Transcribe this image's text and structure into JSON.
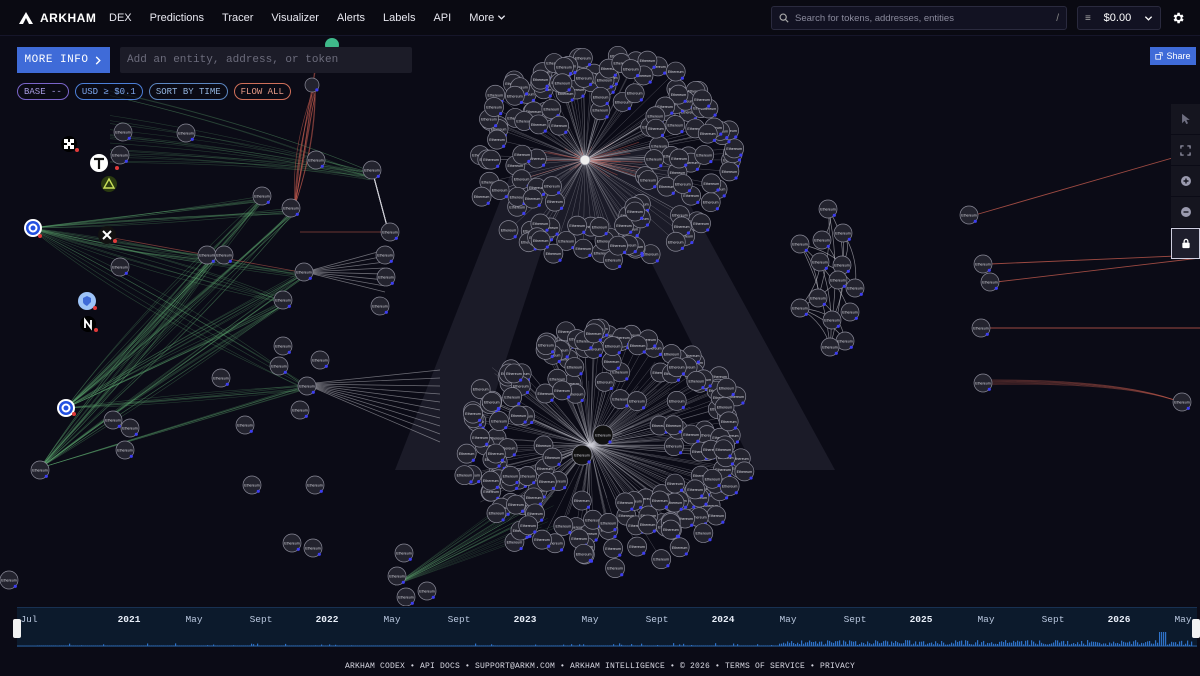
{
  "nav": {
    "brand": "ARKHAM",
    "links": [
      "DEX",
      "Predictions",
      "Tracer",
      "Visualizer",
      "Alerts",
      "Labels",
      "API"
    ],
    "more": "More",
    "search_placeholder": "Search for tokens, addresses, entities",
    "search_hint": "/",
    "balance": "$0.00",
    "balance_icon": "≡"
  },
  "controls": {
    "more_info": "MORE INFO",
    "entity_placeholder": "Add an entity, address, or token",
    "filters": [
      "BASE --",
      "USD ≥ $0.1",
      "SORT BY TIME",
      "FLOW ALL"
    ],
    "share": "Share"
  },
  "toolbar": {
    "tools": [
      "pointer-icon",
      "fit-screen-icon",
      "zoom-in-icon",
      "zoom-out-icon",
      "lock-icon"
    ]
  },
  "timeline": {
    "labels": [
      "Jul",
      "2021",
      "May",
      "Sept",
      "2022",
      "May",
      "Sept",
      "2023",
      "May",
      "Sept",
      "2024",
      "May",
      "Sept",
      "2025",
      "May",
      "Sept",
      "2026",
      "May"
    ],
    "years": [
      "2021",
      "2022",
      "2023",
      "2024",
      "2025",
      "2026"
    ]
  },
  "footer": {
    "text": "ARKHAM CODEX • API DOCS • SUPPORT@ARKM.COM • ARKHAM INTELLIGENCE • © 2026 • TERMS OF SERVICE • PRIVACY"
  },
  "graph": {
    "node_label": "Ethereum",
    "entity_icons": [
      "okx-icon",
      "tether-icon",
      "coinbase-icon",
      "x-icon",
      "shield-token-icon",
      "n-token-icon",
      "coinbase-icon-2",
      "flame-token-icon"
    ],
    "colors": {
      "inflow": "#5fa870",
      "outflow": "#c25a4e",
      "neutral": "#cfcfd6",
      "accent": "#3f6bd8"
    }
  }
}
